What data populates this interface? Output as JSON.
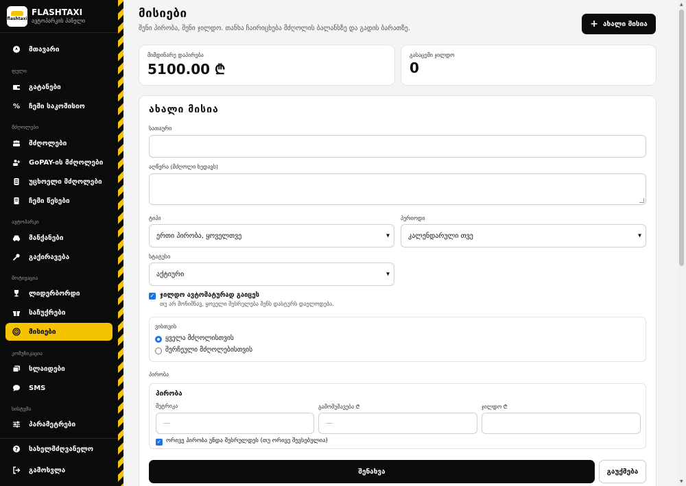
{
  "brand": {
    "title": "FLASHTAXI",
    "subtitle": "ავტოპარკის პანელი",
    "logo_text": "flashtaxi"
  },
  "sidebar": {
    "main_item": "მთავარი",
    "sections": {
      "finance": "ფული",
      "drivers": "მძღოლები",
      "fleet": "ავტოპარკი",
      "motivation": "მოტივაცია",
      "communication": "კომუნიკაცია",
      "system": "სისტემა"
    },
    "items": {
      "transfers": "გატანები",
      "commission": "ჩემი საკომისიო",
      "drivers": "მძღოლები",
      "gopay_drivers": "GoPAY-ის მძღოლები",
      "foreign_drivers": "უცხოელი მძღოლები",
      "my_rules": "ჩემი წესები",
      "cars": "მანქანები",
      "rentals": "გაქირავება",
      "leaderboard": "ლიდერბორდი",
      "gifts": "საჩუქრები",
      "missions": "მისიები",
      "slides": "სლაიდები",
      "sms": "SMS",
      "parameters": "პარამეტრები",
      "guide": "სახელმძღვანელო",
      "logout": "გამოსვლა"
    }
  },
  "page": {
    "title": "მისიები",
    "subtitle": "შენი პირობა, შენი ჯილდო. თანხა ჩაირიცხება მძღოლის ბალანსზე და გადის ბარათზე.",
    "new_button": "ახალი მისია"
  },
  "stats": {
    "current_promise_label": "მიმდინარე დაპირება",
    "current_promise_value": "5100.00 ₾",
    "rewards_paid_label": "გასაცემი ჯილდო",
    "rewards_paid_value": "0"
  },
  "form": {
    "title": "ახალი მისია",
    "title_label": "სათაური",
    "title_value": "",
    "description_label": "აღწერა (მძღოლი ხედავს)",
    "description_value": "",
    "type_label": "ტიპი",
    "type_value": "ერთი პირობა, ყოველთვე",
    "period_label": "პერიოდი",
    "period_value": "კალენდარული თვე",
    "status_label": "სტატუსი",
    "status_value": "აქტიური",
    "auto_reward_label": "ჯილდო ავტომატურად გაიცეს",
    "auto_reward_hint": "თუ არ მონიშნავ, ყოველი შესრულება შენს დასტურს დაელოდება.",
    "auto_reward_checked": true,
    "audience_label": "ვისთვის",
    "audience_all": "ყველა მძღოლისთვის",
    "audience_selected": "შერჩეული მძღოლებისთვის",
    "audience_value": "all",
    "condition_section_label": "პირობა",
    "condition_title": "პირობა",
    "metric_label": "მეტრიკა",
    "metric_placeholder": "—",
    "threshold_label": "გამომუშავება ₾",
    "threshold_placeholder": "—",
    "reward_label": "ჯილდო ₾",
    "reward_value": "",
    "both_required_label": "ორივე პირობა უნდა შესრულდეს (თუ ორივე შევსებულია)",
    "both_required_checked": true,
    "save_button": "შენახვა",
    "cancel_button": "გაუქმება"
  },
  "icons": {
    "home": "home-icon",
    "transfers": "wallet-icon",
    "commission": "percent-icon",
    "drivers": "users-icon",
    "gopay": "user-plus-icon",
    "foreign": "id-card-icon",
    "rules": "document-icon",
    "cars": "car-icon",
    "rentals": "key-icon",
    "leaderboard": "trophy-icon",
    "gifts": "gift-icon",
    "missions": "target-icon",
    "slides": "images-icon",
    "sms": "chat-icon",
    "parameters": "sliders-icon",
    "guide": "help-icon",
    "logout": "logout-icon"
  },
  "colors": {
    "accent": "#f5c400",
    "sidebar_bg": "#0b0b0b",
    "primary_button": "#0b0b0b",
    "checkbox": "#1a73e8"
  }
}
